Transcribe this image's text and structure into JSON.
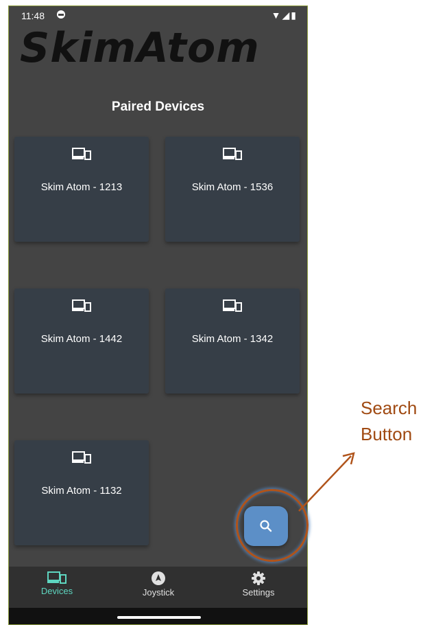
{
  "status_bar": {
    "time": "11:48",
    "icons": [
      "dnd-icon",
      "wifi-icon",
      "signal-icon",
      "battery-icon"
    ]
  },
  "app": {
    "logo": "SkimAtom"
  },
  "main": {
    "section_title": "Paired Devices",
    "devices": [
      {
        "label": "Skim Atom - 1213"
      },
      {
        "label": "Skim Atom - 1536"
      },
      {
        "label": "Skim Atom - 1442"
      },
      {
        "label": "Skim Atom - 1342"
      },
      {
        "label": "Skim Atom - 1132"
      }
    ]
  },
  "fab": {
    "icon": "search-icon"
  },
  "bottom_nav": {
    "items": [
      {
        "label": "Devices",
        "icon": "devices-icon",
        "active": true
      },
      {
        "label": "Joystick",
        "icon": "joystick-icon",
        "active": false
      },
      {
        "label": "Settings",
        "icon": "gear-icon",
        "active": false
      }
    ]
  },
  "annotation": {
    "line1": "Search",
    "line2": "Button"
  },
  "colors": {
    "background": "#444444",
    "card": "#363e47",
    "fab": "#5c8fc7",
    "nav_active": "#5ed6c0",
    "annotation": "#a04a12"
  }
}
